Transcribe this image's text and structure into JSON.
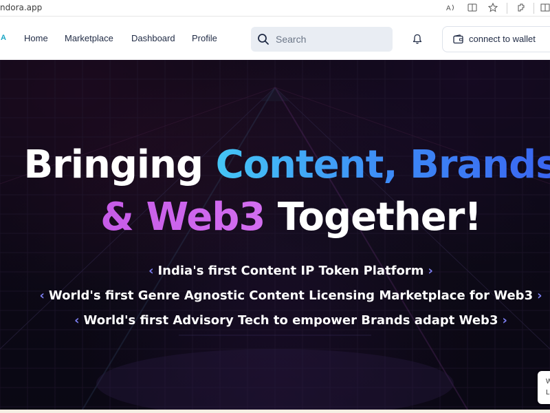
{
  "browser": {
    "url": "ndora.app",
    "icons": [
      "read-aloud-icon",
      "immersive-reader-icon",
      "favorite-star-icon",
      "extensions-icon",
      "split-screen-icon"
    ]
  },
  "nav": {
    "logo_letter": "A",
    "links": [
      "Home",
      "Marketplace",
      "Dashboard",
      "Profile"
    ],
    "search_placeholder": "Search",
    "wallet_label": "connect to wallet"
  },
  "hero": {
    "line1": {
      "part1": "Bringing ",
      "part2": "Content, Brands"
    },
    "line2": {
      "part1": "& Web3",
      "part2": " Together!"
    },
    "taglines": [
      "India's first Content IP Token Platform",
      "World's first Genre Agnostic Content Licensing Marketplace for Web3",
      "World's first Advisory Tech to empower Brands adapt Web3"
    ],
    "chevron_left": "‹",
    "chevron_right": "›"
  },
  "side_widget": {
    "line1": "W",
    "line2": "L"
  },
  "colors": {
    "accent_cyan": "#45c6f6",
    "accent_blue": "#3e6cf0",
    "accent_purple": "#c65be8",
    "hero_bg": "#120d1c"
  }
}
